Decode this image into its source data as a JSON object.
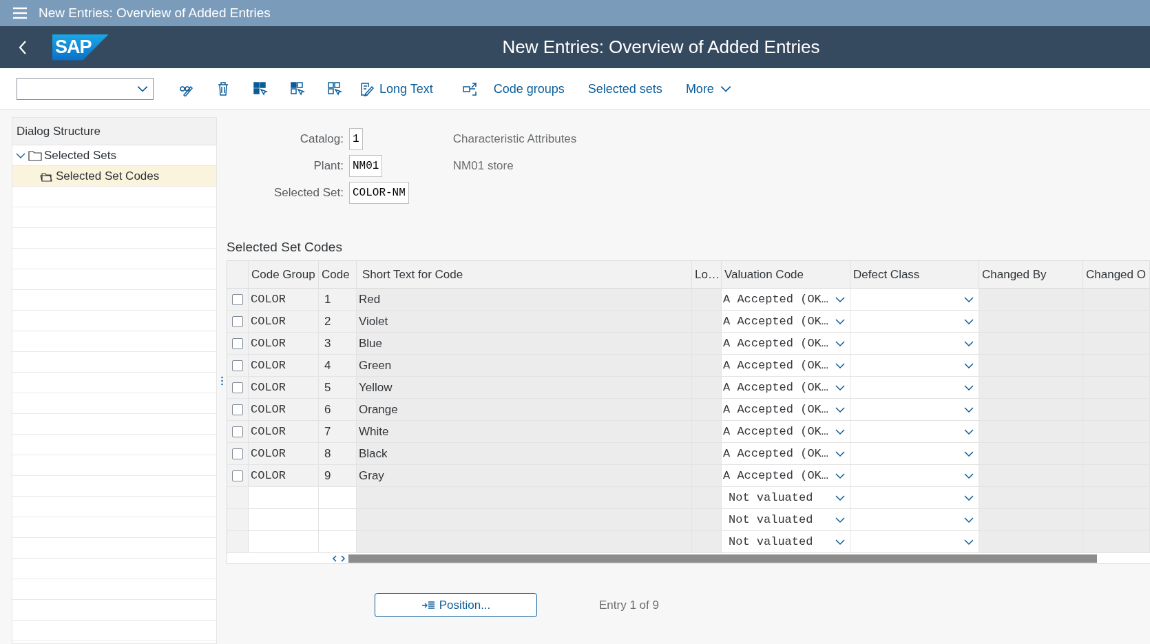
{
  "shell": {
    "title": "New Entries: Overview of Added Entries"
  },
  "header": {
    "logo": "SAP",
    "title": "New Entries: Overview of Added Entries"
  },
  "toolbar": {
    "long_text": "Long Text",
    "links": [
      "Code groups",
      "Selected sets"
    ],
    "more": "More"
  },
  "tree": {
    "title": "Dialog Structure",
    "items": [
      {
        "label": "Selected Sets",
        "expanded": true,
        "selected": false,
        "children": [
          {
            "label": "Selected Set Codes",
            "selected": true
          }
        ]
      }
    ]
  },
  "form": {
    "fields": [
      {
        "label": "Catalog:",
        "value": "1",
        "description": "Characteristic Attributes"
      },
      {
        "label": "Plant:",
        "value": "NM01",
        "description": "NM01 store"
      },
      {
        "label": "Selected Set:",
        "value": "COLOR-NM"
      }
    ]
  },
  "table": {
    "title": "Selected Set Codes",
    "columns": [
      "Code Group",
      "Code",
      "Short Text for Code",
      "Lo…",
      "Valuation Code",
      "Defect Class",
      "Changed By",
      "Changed O"
    ],
    "rows": [
      {
        "kind": "entry",
        "selected": false,
        "code_group": "COLOR",
        "code": "1",
        "short_text": "Red",
        "valuation": "A Accepted (OK…"
      },
      {
        "kind": "entry",
        "selected": false,
        "code_group": "COLOR",
        "code": "2",
        "short_text": "Violet",
        "valuation": "A Accepted (OK…"
      },
      {
        "kind": "entry",
        "selected": false,
        "code_group": "COLOR",
        "code": "3",
        "short_text": "Blue",
        "valuation": "A Accepted (OK…"
      },
      {
        "kind": "entry",
        "selected": false,
        "code_group": "COLOR",
        "code": "4",
        "short_text": "Green",
        "valuation": "A Accepted (OK…"
      },
      {
        "kind": "entry",
        "selected": false,
        "code_group": "COLOR",
        "code": "5",
        "short_text": "Yellow",
        "valuation": "A Accepted (OK…"
      },
      {
        "kind": "entry",
        "selected": false,
        "code_group": "COLOR",
        "code": "6",
        "short_text": "Orange",
        "valuation": "A Accepted (OK…"
      },
      {
        "kind": "entry",
        "selected": false,
        "code_group": "COLOR",
        "code": "7",
        "short_text": "White",
        "valuation": "A Accepted (OK…"
      },
      {
        "kind": "entry",
        "selected": false,
        "code_group": "COLOR",
        "code": "8",
        "short_text": "Black",
        "valuation": "A Accepted (OK…"
      },
      {
        "kind": "entry",
        "selected": false,
        "code_group": "COLOR",
        "code": "9",
        "short_text": "Gray",
        "valuation": "A Accepted (OK…"
      },
      {
        "kind": "new",
        "valuation": "Not valuated"
      },
      {
        "kind": "new",
        "valuation": "Not valuated"
      },
      {
        "kind": "new",
        "valuation": "Not valuated"
      }
    ]
  },
  "footer": {
    "position_button": "Position...",
    "entry_info": "Entry 1 of 9"
  }
}
